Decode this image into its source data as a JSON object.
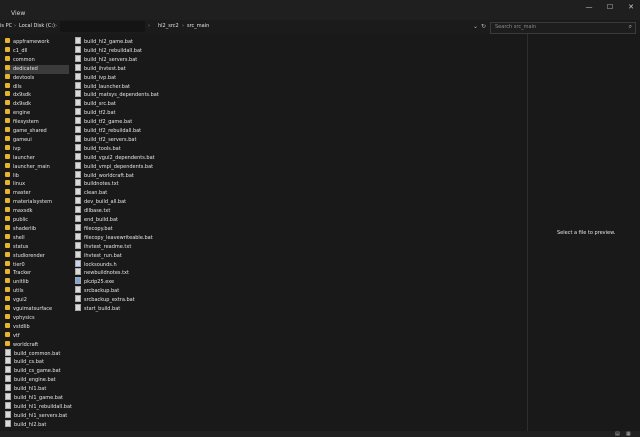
{
  "menu": {
    "view": "View"
  },
  "window": {
    "minimize": "—",
    "maximize": "☐",
    "close": "✕"
  },
  "breadcrumb": [
    "is PC",
    "Local Disk (C:)",
    "hl2_src2",
    "src_main"
  ],
  "breadcrumb_sep": "›",
  "search": {
    "placeholder": "Search src_main"
  },
  "col1": [
    {
      "name": "appframework",
      "type": "folder"
    },
    {
      "name": "c1_dll",
      "type": "folder"
    },
    {
      "name": "common",
      "type": "folder"
    },
    {
      "name": "dedicated",
      "type": "folder",
      "selected": true
    },
    {
      "name": "devtools",
      "type": "folder"
    },
    {
      "name": "dlls",
      "type": "folder"
    },
    {
      "name": "dx9sdk",
      "type": "folder"
    },
    {
      "name": "dx9sdk",
      "type": "folder"
    },
    {
      "name": "engine",
      "type": "folder"
    },
    {
      "name": "filesystem",
      "type": "folder"
    },
    {
      "name": "game_shared",
      "type": "folder"
    },
    {
      "name": "gameui",
      "type": "folder"
    },
    {
      "name": "ivp",
      "type": "folder"
    },
    {
      "name": "launcher",
      "type": "folder"
    },
    {
      "name": "launcher_main",
      "type": "folder"
    },
    {
      "name": "lib",
      "type": "folder"
    },
    {
      "name": "linux",
      "type": "folder"
    },
    {
      "name": "master",
      "type": "folder"
    },
    {
      "name": "materialsystem",
      "type": "folder"
    },
    {
      "name": "maxsdk",
      "type": "folder"
    },
    {
      "name": "public",
      "type": "folder"
    },
    {
      "name": "shaderlib",
      "type": "folder"
    },
    {
      "name": "shell",
      "type": "folder"
    },
    {
      "name": "status",
      "type": "folder"
    },
    {
      "name": "studiorender",
      "type": "folder"
    },
    {
      "name": "tier0",
      "type": "folder"
    },
    {
      "name": "Tracker",
      "type": "folder"
    },
    {
      "name": "unitlib",
      "type": "folder"
    },
    {
      "name": "utils",
      "type": "folder"
    },
    {
      "name": "vgui2",
      "type": "folder"
    },
    {
      "name": "vguimatsurface",
      "type": "folder"
    },
    {
      "name": "vphysics",
      "type": "folder"
    },
    {
      "name": "vstdlib",
      "type": "folder"
    },
    {
      "name": "vtf",
      "type": "folder"
    },
    {
      "name": "worldcraft",
      "type": "folder"
    },
    {
      "name": "build_common.bat",
      "type": "file"
    },
    {
      "name": "build_cs.bat",
      "type": "file"
    },
    {
      "name": "build_cs_game.bat",
      "type": "file"
    },
    {
      "name": "build_engine.bat",
      "type": "file"
    },
    {
      "name": "build_hl1.bat",
      "type": "file"
    },
    {
      "name": "build_hl1_game.bat",
      "type": "file"
    },
    {
      "name": "build_hl1_rebuildall.bat",
      "type": "file"
    },
    {
      "name": "build_hl1_servers.bat",
      "type": "file"
    },
    {
      "name": "build_hl2.bat",
      "type": "file"
    }
  ],
  "col2": [
    {
      "name": "build_hl2_game.bat",
      "type": "file"
    },
    {
      "name": "build_hl2_rebuildall.bat",
      "type": "file"
    },
    {
      "name": "build_hl2_servers.bat",
      "type": "file"
    },
    {
      "name": "build_ihvtest.bat",
      "type": "file"
    },
    {
      "name": "build_ivp.bat",
      "type": "file"
    },
    {
      "name": "build_launcher.bat",
      "type": "file"
    },
    {
      "name": "build_matsys_dependents.bat",
      "type": "file"
    },
    {
      "name": "build_src.bat",
      "type": "file"
    },
    {
      "name": "build_tf2.bat",
      "type": "file"
    },
    {
      "name": "build_tf2_game.bat",
      "type": "file"
    },
    {
      "name": "build_tf2_rebuildall.bat",
      "type": "file"
    },
    {
      "name": "build_tf2_servers.bat",
      "type": "file"
    },
    {
      "name": "build_tools.bat",
      "type": "file"
    },
    {
      "name": "build_vgui2_dependents.bat",
      "type": "file"
    },
    {
      "name": "build_vmpi_dependents.bat",
      "type": "file"
    },
    {
      "name": "build_worldcraft.bat",
      "type": "file"
    },
    {
      "name": "buildnotes.txt",
      "type": "file"
    },
    {
      "name": "clean.bat",
      "type": "file"
    },
    {
      "name": "dev_build_all.bat",
      "type": "file"
    },
    {
      "name": "dllbase.txt",
      "type": "file"
    },
    {
      "name": "end_build.bat",
      "type": "file"
    },
    {
      "name": "filecopy.bat",
      "type": "file"
    },
    {
      "name": "filecopy_leavewriteable.bat",
      "type": "file"
    },
    {
      "name": "ihvtest_readme.txt",
      "type": "file"
    },
    {
      "name": "ihvtest_run.bat",
      "type": "file"
    },
    {
      "name": "locksounds.h",
      "type": "h"
    },
    {
      "name": "newbuildnotes.txt",
      "type": "file"
    },
    {
      "name": "pkzip25.exe",
      "type": "exe"
    },
    {
      "name": "srcbackup.bat",
      "type": "file"
    },
    {
      "name": "srcbackup_extra.bat",
      "type": "file"
    },
    {
      "name": "start_build.bat",
      "type": "file"
    }
  ],
  "preview": {
    "message": "Select a file to preview."
  },
  "colors": {
    "folder": "#e8b32d",
    "selected": "#3b3b3b",
    "background": "#191919"
  },
  "icons": {
    "refresh": "↻",
    "dropdown": "⌄",
    "search": "⌕"
  }
}
